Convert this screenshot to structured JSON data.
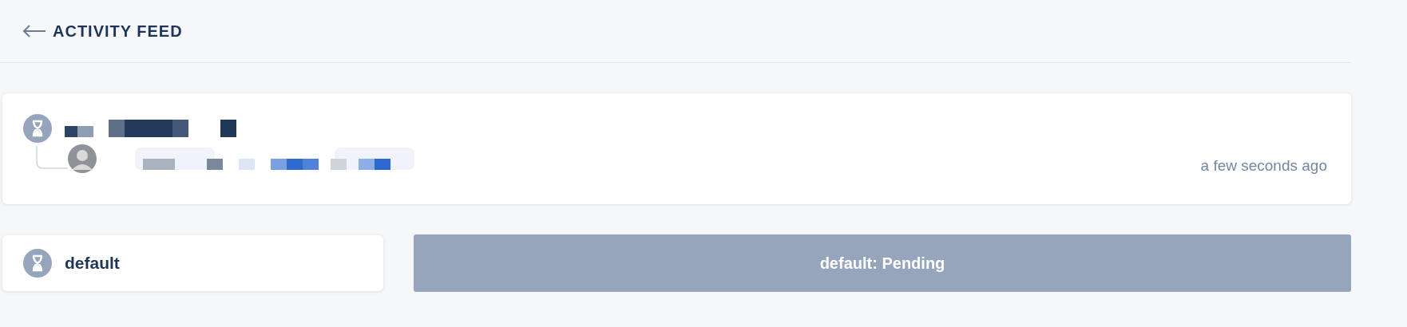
{
  "header": {
    "title": "ACTIVITY FEED"
  },
  "activity": {
    "kind": "pending",
    "time": "a few seconds ago"
  },
  "job": {
    "kind": "pending",
    "name": "default",
    "bar_label": "default: Pending"
  }
}
